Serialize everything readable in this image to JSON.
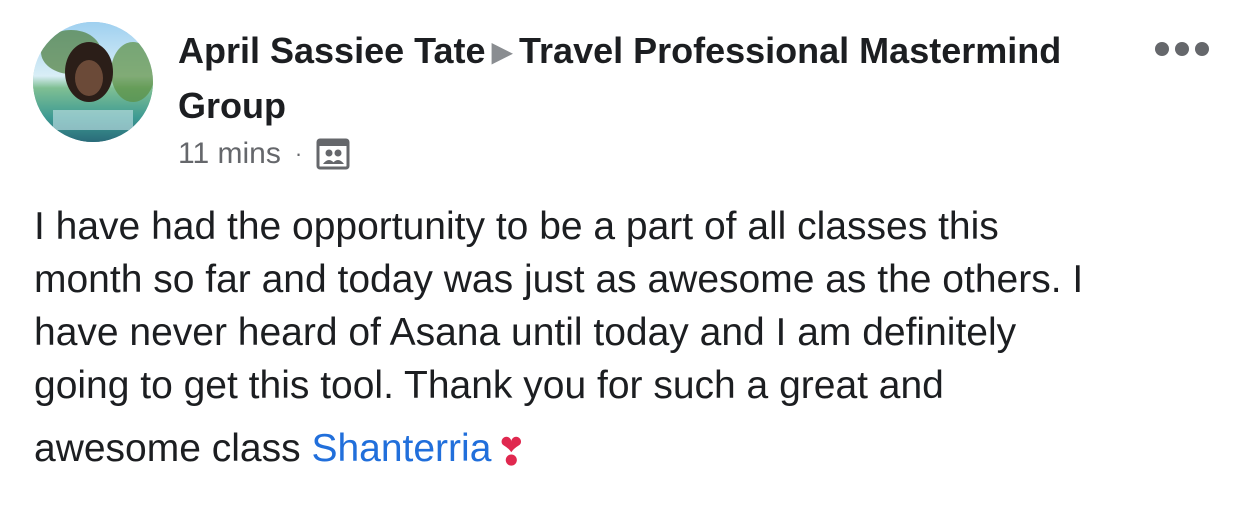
{
  "post": {
    "author": "April Sassiee Tate",
    "group": "Travel Professional Mastermind Group",
    "time": "11 mins",
    "separator": "·",
    "privacy_icon": "group-members-icon",
    "more_icon": "more-options-icon",
    "body_lines": [
      "I have had the opportunity to be a part of all classes this",
      "month so far and today was just as awesome as the others. I",
      "have never heard of Asana until today and I am definitely",
      "going to get this tool. Thank you for such a great and",
      "awesome class"
    ],
    "mention": "Shanterria",
    "emoji": "❣"
  },
  "colors": {
    "mention": "#216fdb",
    "secondary_text": "#65676b",
    "heart": "#e0284f"
  }
}
